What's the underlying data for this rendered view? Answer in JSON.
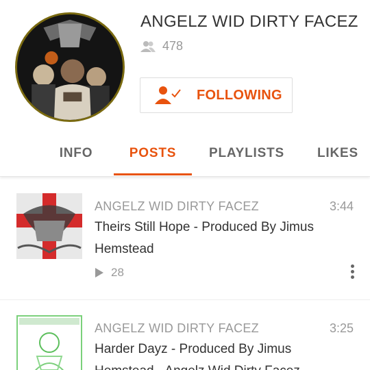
{
  "profile": {
    "name": "ANGELZ WID DIRTY FACEZ",
    "followers_count": "478",
    "follow_button_label": "FOLLOWING"
  },
  "tabs": [
    {
      "label": "INFO",
      "active": false
    },
    {
      "label": "POSTS",
      "active": true
    },
    {
      "label": "PLAYLISTS",
      "active": false
    },
    {
      "label": "LIKES",
      "active": false
    }
  ],
  "tracks": [
    {
      "artist": "ANGELZ WID DIRTY FACEZ",
      "duration": "3:44",
      "title": "Theirs Still Hope - Produced By Jimus Hemstead",
      "plays": "28"
    },
    {
      "artist": "ANGELZ WID DIRTY FACEZ",
      "duration": "3:25",
      "title": "Harder Dayz - Produced By Jimus Hemstead - Angelz Wid Dirty Facez",
      "plays": ""
    }
  ],
  "colors": {
    "accent": "#e8530e",
    "muted_text": "#999999",
    "primary_text": "#333333"
  },
  "icons": {
    "followers": "people-icon",
    "following": "user-check-icon",
    "play": "play-icon",
    "more": "more-vertical-icon"
  }
}
